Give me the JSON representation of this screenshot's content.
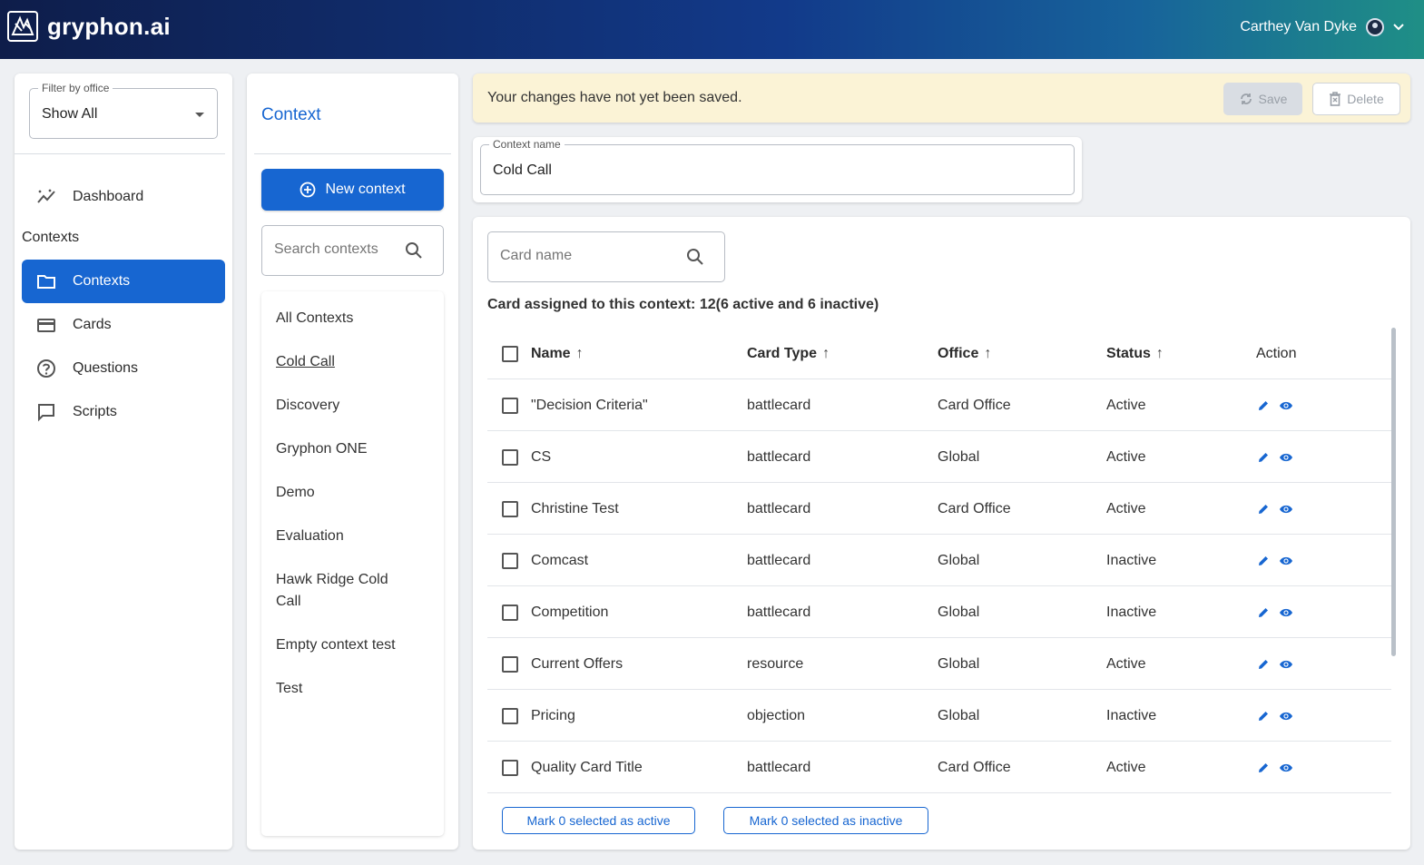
{
  "app": {
    "name": "gryphon.ai"
  },
  "user": {
    "name": "Carthey Van Dyke"
  },
  "sidebar": {
    "filter": {
      "label": "Filter by office",
      "value": "Show All"
    },
    "dashboard_label": "Dashboard",
    "section_label": "Contexts",
    "items": [
      {
        "label": "Contexts",
        "icon": "folder-icon",
        "active": true
      },
      {
        "label": "Cards",
        "icon": "card-icon",
        "active": false
      },
      {
        "label": "Questions",
        "icon": "question-icon",
        "active": false
      },
      {
        "label": "Scripts",
        "icon": "script-icon",
        "active": false
      }
    ]
  },
  "context_panel": {
    "title": "Context",
    "new_button": "New context",
    "search_placeholder": "Search contexts",
    "items": [
      "All Contexts",
      "Cold Call",
      "Discovery",
      "Gryphon ONE",
      "Demo",
      "Evaluation",
      "Hawk Ridge Cold Call",
      "Empty context test",
      "Test"
    ],
    "selected": "Cold Call"
  },
  "banner": {
    "message": "Your changes have not yet been saved.",
    "save_label": "Save",
    "delete_label": "Delete"
  },
  "context_name": {
    "label": "Context name",
    "value": "Cold Call"
  },
  "cards": {
    "search_placeholder": "Card name",
    "assigned_text": "Card assigned to this context: 12(6 active and 6 inactive)",
    "columns": [
      "Name",
      "Card Type",
      "Office",
      "Status",
      "Action"
    ],
    "rows": [
      {
        "name": "\"Decision Criteria\"",
        "type": "battlecard",
        "office": "Card Office",
        "status": "Active"
      },
      {
        "name": "CS",
        "type": "battlecard",
        "office": "Global",
        "status": "Active"
      },
      {
        "name": "Christine Test",
        "type": "battlecard",
        "office": "Card Office",
        "status": "Active"
      },
      {
        "name": "Comcast",
        "type": "battlecard",
        "office": "Global",
        "status": "Inactive"
      },
      {
        "name": "Competition",
        "type": "battlecard",
        "office": "Global",
        "status": "Inactive"
      },
      {
        "name": "Current Offers",
        "type": "resource",
        "office": "Global",
        "status": "Active"
      },
      {
        "name": "Pricing",
        "type": "objection",
        "office": "Global",
        "status": "Inactive"
      },
      {
        "name": "Quality Card Title",
        "type": "battlecard",
        "office": "Card Office",
        "status": "Active"
      }
    ],
    "mark_active_label": "Mark 0 selected as active",
    "mark_inactive_label": "Mark 0 selected as inactive"
  },
  "colors": {
    "primary": "#1766d1",
    "banner_bg": "#fbf3d6",
    "header_start": "#0e1d4a",
    "header_end": "#1f8f86"
  }
}
